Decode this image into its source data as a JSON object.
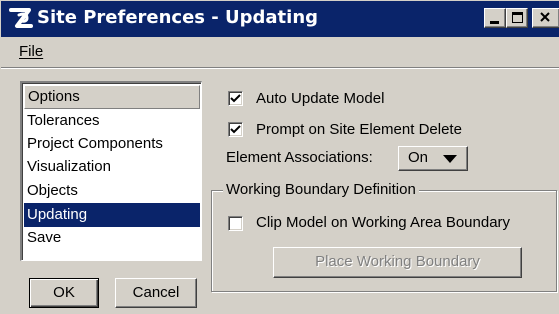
{
  "window": {
    "title": "Site Preferences - Updating"
  },
  "colors": {
    "titlebar": "#0a246a",
    "face": "#d4d0c8",
    "selection": "#0a246a",
    "disabled_text": "#808080"
  },
  "icons": {
    "app": "site-app-icon",
    "minimize": "minimize-icon",
    "maximize": "maximize-icon",
    "close": "close-icon"
  },
  "menu": {
    "file_label": "File"
  },
  "options": {
    "header": "Options",
    "items": [
      {
        "label": "Tolerances",
        "selected": false
      },
      {
        "label": "Project Components",
        "selected": false
      },
      {
        "label": "Visualization",
        "selected": false
      },
      {
        "label": "Objects",
        "selected": false
      },
      {
        "label": "Updating",
        "selected": true
      },
      {
        "label": "Save",
        "selected": false
      }
    ]
  },
  "buttons": {
    "ok": "OK",
    "cancel": "Cancel"
  },
  "updating": {
    "auto_update": {
      "label": "Auto Update Model",
      "checked": true
    },
    "prompt_delete": {
      "label": "Prompt on Site Element Delete",
      "checked": true
    },
    "associations": {
      "label": "Element Associations:",
      "value": "On"
    },
    "boundary": {
      "group_title": "Working Boundary Definition",
      "clip": {
        "label": "Clip Model on Working Area Boundary",
        "checked": false
      },
      "place_button": "Place Working Boundary",
      "place_enabled": false
    }
  }
}
